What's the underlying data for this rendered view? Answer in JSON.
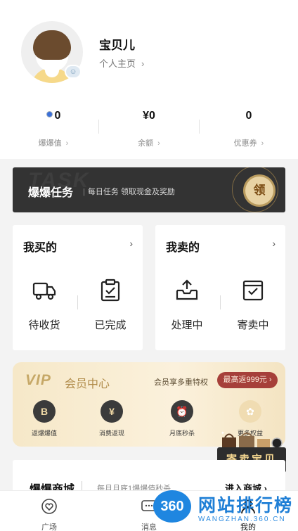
{
  "profile": {
    "username": "宝贝儿",
    "homepage_label": "个人主页",
    "chevron": "›",
    "avatar_icon": "avatar-icon",
    "level_icon": "level-badge-icon"
  },
  "stats": [
    {
      "value": "0",
      "label": "爆爆值",
      "icon": "coin-icon"
    },
    {
      "value": "¥0",
      "label": "余额"
    },
    {
      "value": "0",
      "label": "优惠券"
    }
  ],
  "task_banner": {
    "ghost_text": "TASK",
    "title": "爆爆任务",
    "subtitle": "每日任务 领取现金及奖励",
    "claim_label": "领"
  },
  "buy_card": {
    "title": "我买的",
    "items": [
      {
        "label": "待收货",
        "icon": "truck-icon"
      },
      {
        "label": "已完成",
        "icon": "clipboard-check-icon"
      }
    ]
  },
  "sell_card": {
    "title": "我卖的",
    "items": [
      {
        "label": "处理中",
        "icon": "inbox-upload-icon"
      },
      {
        "label": "寄卖中",
        "icon": "checkbox-icon"
      }
    ]
  },
  "vip": {
    "logo": "VIP",
    "title": "会员中心",
    "privileges": "会员享多重特权",
    "max_return": "最高返999元",
    "items": [
      {
        "glyph": "B",
        "label": "返爆爆值"
      },
      {
        "glyph": "¥",
        "label": "消费返现"
      },
      {
        "glyph": "⏰",
        "label": "月底秒杀"
      },
      {
        "glyph": "✿",
        "label": "更多权益"
      }
    ]
  },
  "consign_banner": {
    "label": "寄卖宝贝"
  },
  "mall": {
    "title": "爆爆商城",
    "subtitle": "每月月底1爆爆值秒杀",
    "enter_label": "进入商城",
    "chevron": "›"
  },
  "tabbar": {
    "tabs": [
      {
        "label": "广场",
        "icon": "heart-chat-icon"
      },
      {
        "label": "消息",
        "icon": "message-icon"
      },
      {
        "label": "我的",
        "icon": "person-icon"
      }
    ]
  },
  "watermark": {
    "badge": "360",
    "text": "网站排行榜",
    "url": "WANGZHAN.360.CN"
  },
  "colors": {
    "banner_dark": "#333333",
    "gold": "#e8d3a4",
    "vip_red": "#a6403a",
    "watermark_blue": "#1f86e0"
  }
}
